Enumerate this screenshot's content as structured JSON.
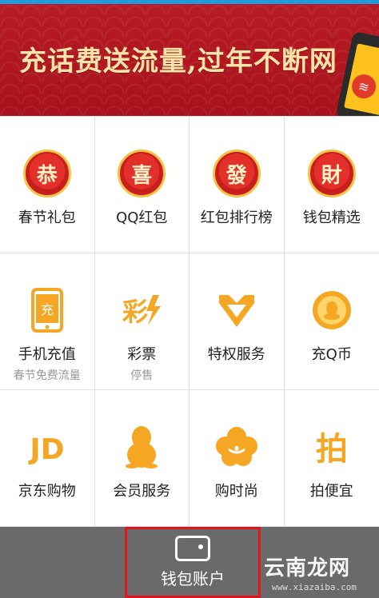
{
  "banner": {
    "title": "充话费送流量,过年不断网"
  },
  "grid": {
    "items": [
      {
        "label": "春节礼包",
        "icon": "gong-seal-icon",
        "glyph": "恭"
      },
      {
        "label": "QQ红包",
        "icon": "xi-seal-icon",
        "glyph": "喜"
      },
      {
        "label": "红包排行榜",
        "icon": "fa-seal-icon",
        "glyph": "發"
      },
      {
        "label": "钱包精选",
        "icon": "cai-seal-icon",
        "glyph": "財"
      },
      {
        "label": "手机充值",
        "sub": "春节免费流量",
        "icon": "phone-recharge-icon",
        "glyph": "充"
      },
      {
        "label": "彩票",
        "sub": "停售",
        "icon": "lottery-icon",
        "glyph": "彩"
      },
      {
        "label": "特权服务",
        "icon": "diamond-crown-icon"
      },
      {
        "label": "充Q币",
        "icon": "qq-coin-icon"
      },
      {
        "label": "京东购物",
        "icon": "jd-icon",
        "glyph": "JD"
      },
      {
        "label": "会员服务",
        "icon": "qq-penguin-icon"
      },
      {
        "label": "购时尚",
        "icon": "fashion-flower-icon"
      },
      {
        "label": "拍便宜",
        "icon": "pai-icon",
        "glyph": "拍"
      }
    ]
  },
  "bottom": {
    "wallet_label": "钱包账户"
  },
  "watermark": {
    "text": "云南龙网",
    "url": "www.xiazaiba.com"
  },
  "colors": {
    "banner_red": "#b81c26",
    "accent_yellow": "#f5a623",
    "bottom_bar": "#6a6a6a",
    "highlight_red": "#e0161a"
  }
}
